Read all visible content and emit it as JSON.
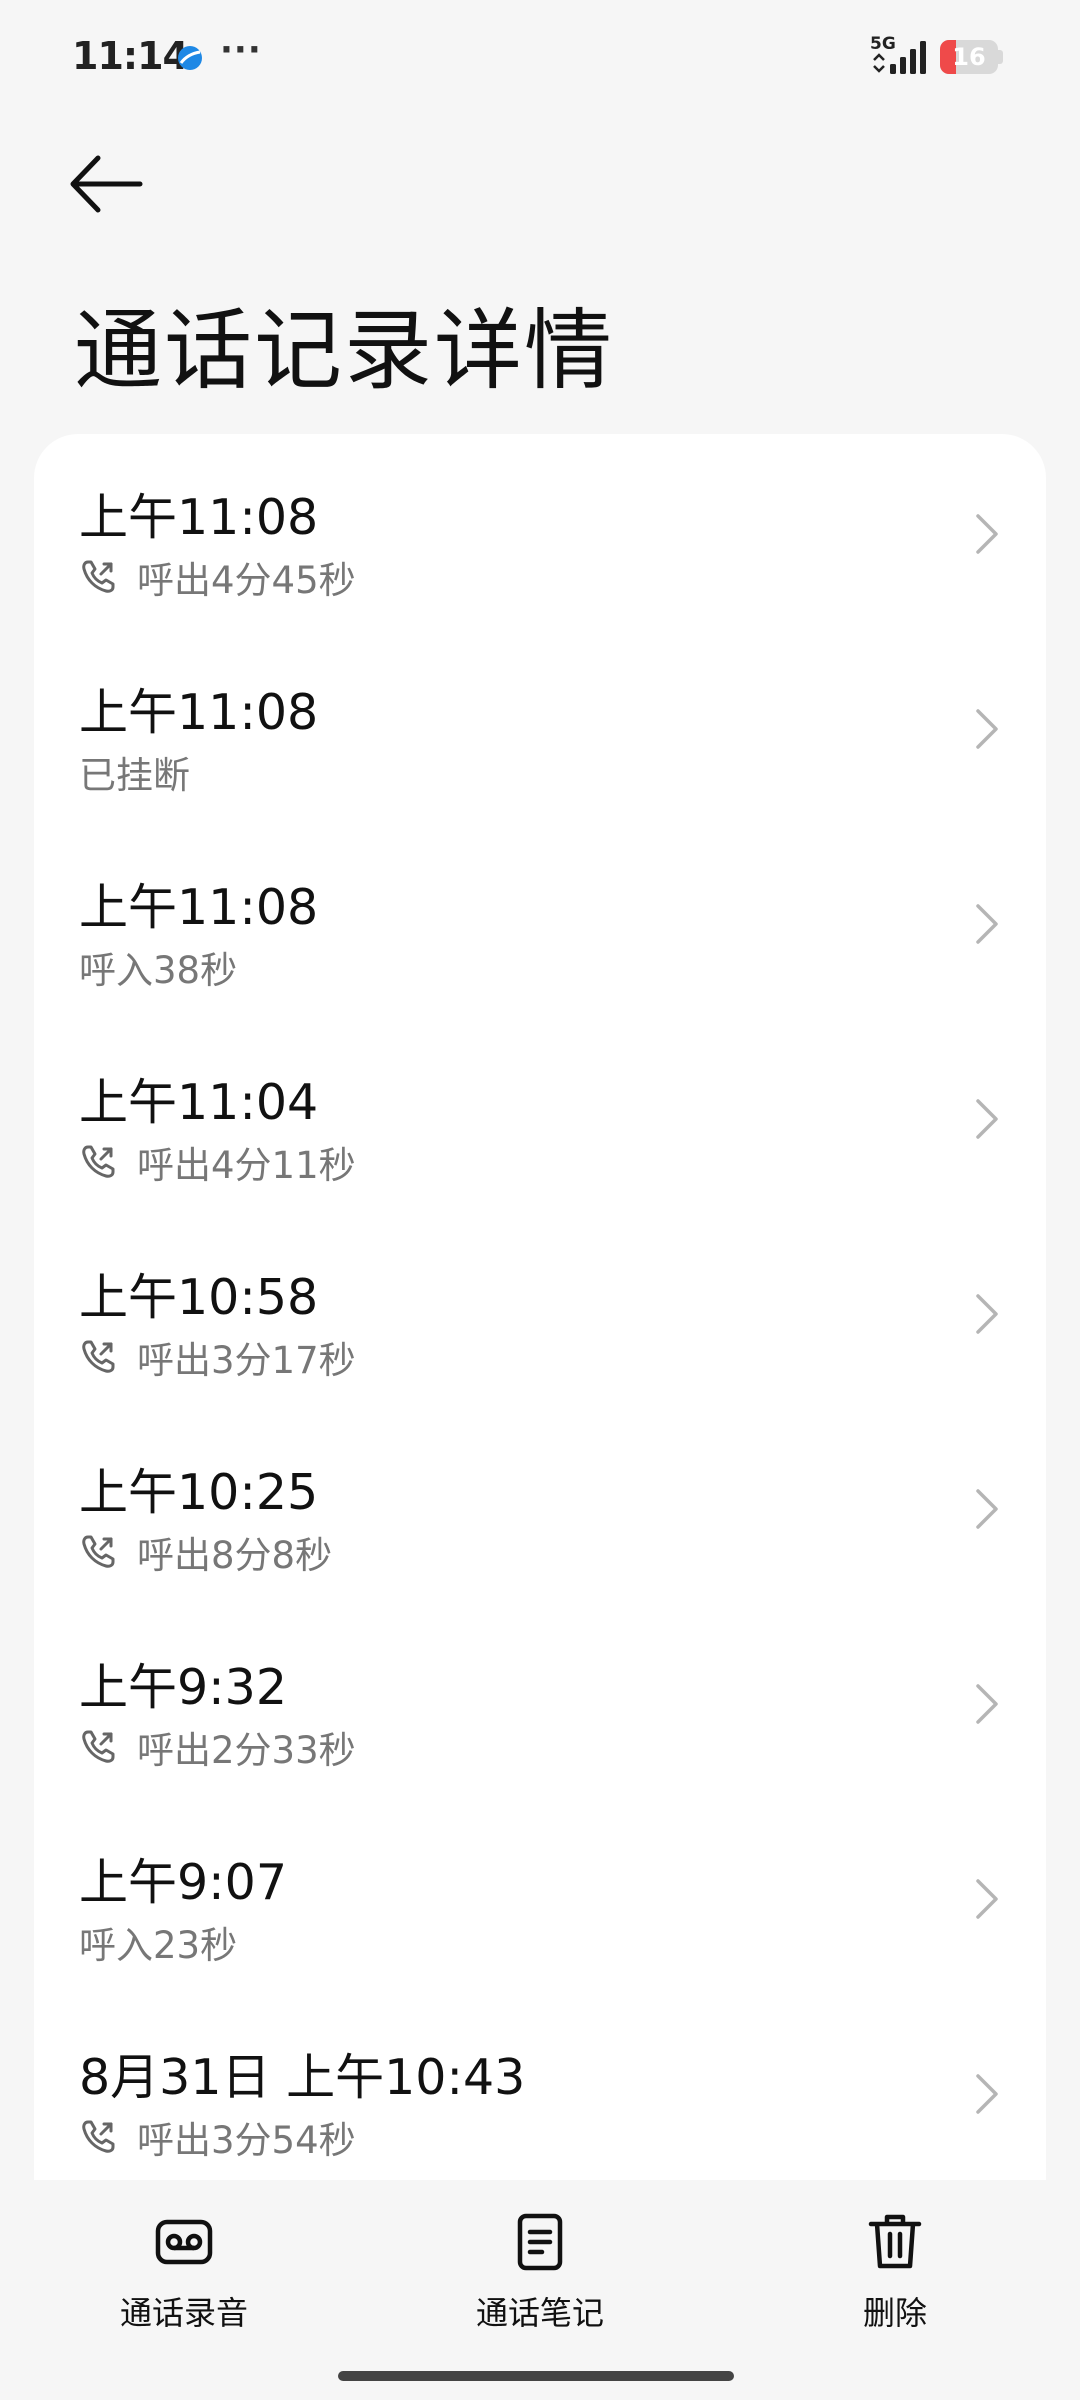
{
  "status_bar": {
    "time": "11:14",
    "network": "5G",
    "battery": "16",
    "battery_level": 0.16,
    "more": "···",
    "colors": {
      "battery_low": "#ef4a4a",
      "app_icon": "#1e88e5"
    }
  },
  "header": {
    "back_icon": "arrow-left-icon",
    "title": "通话记录详情"
  },
  "calls": [
    {
      "time": "上午11:08",
      "detail": "呼出4分45秒",
      "outgoing": true
    },
    {
      "time": "上午11:08",
      "detail": "已挂断",
      "outgoing": false
    },
    {
      "time": "上午11:08",
      "detail": "呼入38秒",
      "outgoing": false
    },
    {
      "time": "上午11:04",
      "detail": "呼出4分11秒",
      "outgoing": true
    },
    {
      "time": "上午10:58",
      "detail": "呼出3分17秒",
      "outgoing": true
    },
    {
      "time": "上午10:25",
      "detail": "呼出8分8秒",
      "outgoing": true
    },
    {
      "time": "上午9:32",
      "detail": "呼出2分33秒",
      "outgoing": true
    },
    {
      "time": "上午9:07",
      "detail": "呼入23秒",
      "outgoing": false
    },
    {
      "time": "8月31日 上午10:43",
      "detail": "呼出3分54秒",
      "outgoing": true
    }
  ],
  "bottom_actions": [
    {
      "label": "通话录音",
      "icon": "cassette-icon"
    },
    {
      "label": "通话笔记",
      "icon": "note-icon"
    },
    {
      "label": "删除",
      "icon": "trash-icon"
    }
  ]
}
